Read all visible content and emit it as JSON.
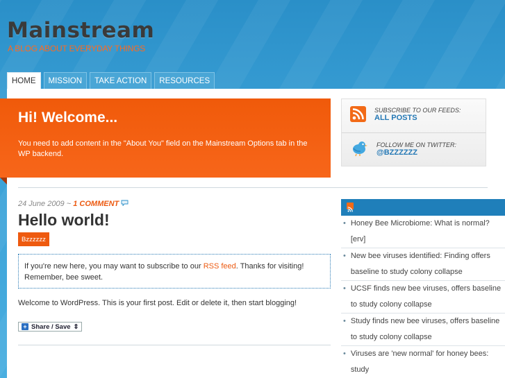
{
  "site": {
    "title": "Mainstream",
    "tagline": "A BLOG ABOUT EVERYDAY THINGS"
  },
  "nav": {
    "tabs": [
      {
        "label": "HOME",
        "active": true
      },
      {
        "label": "MISSION",
        "active": false
      },
      {
        "label": "TAKE ACTION",
        "active": false
      },
      {
        "label": "RESOURCES",
        "active": false
      }
    ]
  },
  "welcome": {
    "heading": "Hi! Welcome...",
    "text": "You need to add content in the \"About You\" field on the Mainstream Options tab in the WP backend."
  },
  "subscribe": {
    "feeds_caption": "SUBSCRIBE TO OUR FEEDS:",
    "feeds_link": "ALL POSTS",
    "twitter_caption": "FOLLOW ME ON TWITTER:",
    "twitter_link": "@BZZZZZZ"
  },
  "post": {
    "date": "24 June 2009",
    "separator": "~",
    "comments_link": "1 COMMENT",
    "title": "Hello world!",
    "tag": "Bzzzzzz",
    "notice_before": "If you're new here, you may want to subscribe to our",
    "notice_link": "RSS feed",
    "notice_after": ". Thanks for visiting! Remember, bee sweet.",
    "body": "Welcome to WordPress. This is your first post. Edit or delete it, then start blogging!",
    "share_label": "Share / Save",
    "share_caret": "⇕"
  },
  "feed": {
    "items": [
      "Honey Bee Microbiome: What is normal? [erv]",
      "New bee viruses identified: Finding offers baseline to study colony collapse",
      "UCSF finds new bee viruses, offers baseline to study colony collapse",
      "Study finds new bee viruses, offers baseline to study colony collapse",
      "Viruses are 'new normal' for honey bees: study"
    ]
  },
  "colors": {
    "accent_orange": "#f05a0a",
    "link_blue": "#2478b5",
    "sky_blue": "#2a8fc8"
  },
  "icons": {
    "feed": "rss-icon",
    "twitter": "twitter-bird-icon",
    "comment": "speech-bubble-icon",
    "share": "plus-icon"
  }
}
